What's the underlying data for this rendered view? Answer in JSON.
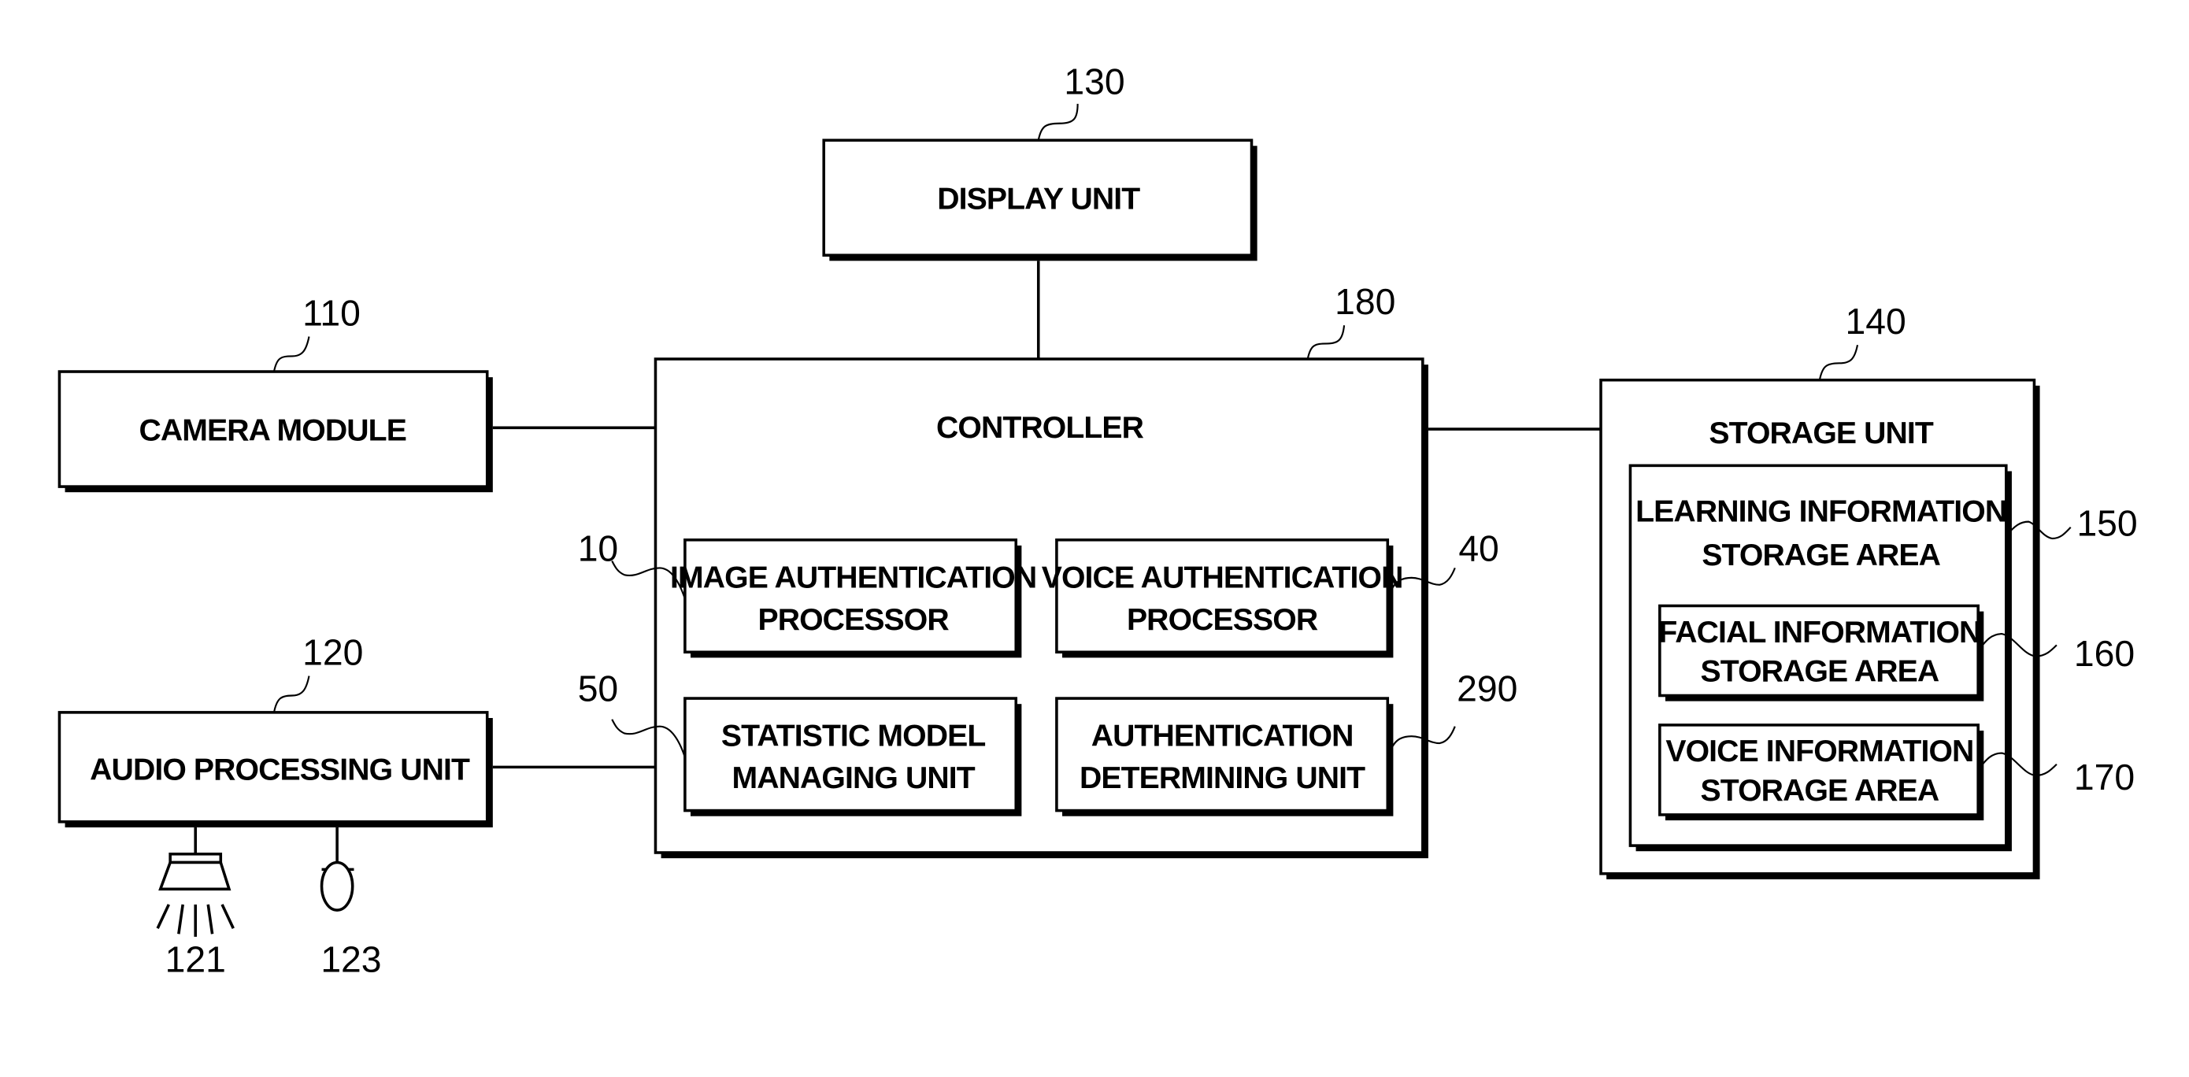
{
  "figure": {
    "display_unit": {
      "ref": "130",
      "label": "DISPLAY UNIT"
    },
    "camera_module": {
      "ref": "110",
      "label": "CAMERA MODULE"
    },
    "audio_processing_unit": {
      "ref": "120",
      "label": "AUDIO PROCESSING UNIT"
    },
    "speaker": {
      "ref": "121"
    },
    "microphone": {
      "ref": "123"
    },
    "controller": {
      "ref": "180",
      "label": "CONTROLLER",
      "image_auth": {
        "ref": "10",
        "line1": "IMAGE AUTHENTICATION",
        "line2": "PROCESSOR"
      },
      "voice_auth": {
        "ref": "40",
        "line1": "VOICE AUTHENTICATION",
        "line2": "PROCESSOR"
      },
      "statistic_model": {
        "ref": "50",
        "line1": "STATISTIC MODEL",
        "line2": "MANAGING UNIT"
      },
      "auth_determining": {
        "ref": "290",
        "line1": "AUTHENTICATION",
        "line2": "DETERMINING UNIT"
      }
    },
    "storage_unit": {
      "ref": "140",
      "label": "STORAGE UNIT",
      "learning_area": {
        "ref": "150",
        "line1": "LEARNING INFORMATION",
        "line2": "STORAGE AREA"
      },
      "facial_area": {
        "ref": "160",
        "line1": "FACIAL INFORMATION",
        "line2": "STORAGE AREA"
      },
      "voice_area": {
        "ref": "170",
        "line1": "VOICE INFORMATION",
        "line2": "STORAGE AREA"
      }
    }
  }
}
